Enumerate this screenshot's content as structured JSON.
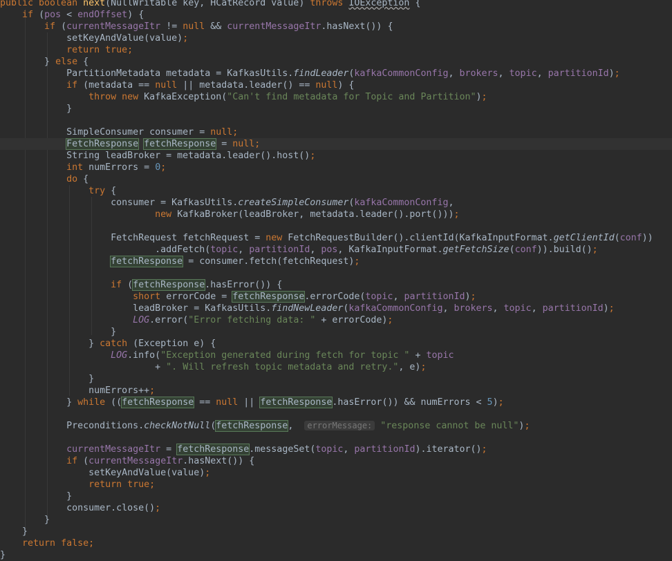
{
  "editor": {
    "theme_colors": {
      "background": "#2b2b2b",
      "text": "#a9b7c6",
      "keyword": "#cc7832",
      "field": "#9876aa",
      "method_declaration": "#ffc66d",
      "string": "#6a8759",
      "number": "#6897bb",
      "highlight": "#344134"
    },
    "lines": [
      {
        "segments": [
          {
            "t": "public boolean ",
            "c": "kw"
          },
          {
            "t": "next",
            "c": "fn"
          },
          {
            "t": "(NullWritable key, HCatRecord value) "
          },
          {
            "t": "throws ",
            "c": "kw"
          },
          {
            "t": "IOException",
            "c": "squiggle"
          },
          {
            "t": " {"
          }
        ]
      },
      {
        "segments": [
          {
            "t": "    "
          },
          {
            "t": "if ",
            "c": "kw"
          },
          {
            "t": "("
          },
          {
            "t": "pos",
            "c": "fld"
          },
          {
            "t": " < "
          },
          {
            "t": "endOffset",
            "c": "fld"
          },
          {
            "t": ") {"
          }
        ]
      },
      {
        "segments": [
          {
            "t": "        "
          },
          {
            "t": "if ",
            "c": "kw"
          },
          {
            "t": "("
          },
          {
            "t": "currentMessageItr",
            "c": "fld"
          },
          {
            "t": " != "
          },
          {
            "t": "null",
            "c": "kw"
          },
          {
            "t": " && "
          },
          {
            "t": "currentMessageItr",
            "c": "fld"
          },
          {
            "t": ".hasNext()) {"
          }
        ]
      },
      {
        "segments": [
          {
            "t": "            setKeyAndValue(value)"
          },
          {
            "t": ";",
            "c": "kw"
          }
        ]
      },
      {
        "segments": [
          {
            "t": "            "
          },
          {
            "t": "return true;",
            "c": "kw"
          }
        ]
      },
      {
        "segments": [
          {
            "t": "        } "
          },
          {
            "t": "else ",
            "c": "kw"
          },
          {
            "t": "{"
          }
        ]
      },
      {
        "segments": [
          {
            "t": "            PartitionMetadata metadata = KafkasUtils."
          },
          {
            "t": "findLeader",
            "c": "ital"
          },
          {
            "t": "("
          },
          {
            "t": "kafkaCommonConfig",
            "c": "fld"
          },
          {
            "t": ", "
          },
          {
            "t": "brokers",
            "c": "fld"
          },
          {
            "t": ", "
          },
          {
            "t": "topic",
            "c": "fld"
          },
          {
            "t": ", "
          },
          {
            "t": "partitionId",
            "c": "fld"
          },
          {
            "t": ")"
          },
          {
            "t": ";",
            "c": "kw"
          }
        ]
      },
      {
        "segments": [
          {
            "t": "            "
          },
          {
            "t": "if ",
            "c": "kw"
          },
          {
            "t": "(metadata == "
          },
          {
            "t": "null",
            "c": "kw"
          },
          {
            "t": " || metadata.leader() == "
          },
          {
            "t": "null",
            "c": "kw"
          },
          {
            "t": ") {"
          }
        ]
      },
      {
        "segments": [
          {
            "t": "                "
          },
          {
            "t": "throw new ",
            "c": "kw"
          },
          {
            "t": "KafkaException("
          },
          {
            "t": "\"Can't find metadata for Topic and Partition\"",
            "c": "str"
          },
          {
            "t": ")"
          },
          {
            "t": ";",
            "c": "kw"
          }
        ]
      },
      {
        "segments": [
          {
            "t": "            }"
          }
        ]
      },
      {
        "segments": []
      },
      {
        "segments": [
          {
            "t": "            SimpleConsumer consumer = "
          },
          {
            "t": "null;",
            "c": "kw"
          }
        ]
      },
      {
        "current": true,
        "segments": [
          {
            "t": "            "
          },
          {
            "t": "FetchResponse",
            "c": "hl"
          },
          {
            "t": " "
          },
          {
            "t": "fetchResponse",
            "c": "hl"
          },
          {
            "t": " = "
          },
          {
            "t": "null;",
            "c": "kw"
          }
        ]
      },
      {
        "segments": [
          {
            "t": "            String leadBroker = metadata.leader().host()"
          },
          {
            "t": ";",
            "c": "kw"
          }
        ]
      },
      {
        "segments": [
          {
            "t": "            "
          },
          {
            "t": "int ",
            "c": "kw"
          },
          {
            "t": "numErrors = "
          },
          {
            "t": "0",
            "c": "num"
          },
          {
            "t": ";",
            "c": "kw"
          }
        ]
      },
      {
        "segments": [
          {
            "t": "            "
          },
          {
            "t": "do ",
            "c": "kw"
          },
          {
            "t": "{"
          }
        ]
      },
      {
        "segments": [
          {
            "t": "                "
          },
          {
            "t": "try ",
            "c": "kw"
          },
          {
            "t": "{"
          }
        ]
      },
      {
        "segments": [
          {
            "t": "                    consumer = KafkasUtils."
          },
          {
            "t": "createSimpleConsumer",
            "c": "ital"
          },
          {
            "t": "("
          },
          {
            "t": "kafkaCommonConfig",
            "c": "fld"
          },
          {
            "t": ","
          }
        ]
      },
      {
        "segments": [
          {
            "t": "                            "
          },
          {
            "t": "new ",
            "c": "kw"
          },
          {
            "t": "KafkaBroker(leadBroker, metadata.leader().port()))"
          },
          {
            "t": ";",
            "c": "kw"
          }
        ]
      },
      {
        "segments": []
      },
      {
        "segments": [
          {
            "t": "                    FetchRequest fetchRequest = "
          },
          {
            "t": "new ",
            "c": "kw"
          },
          {
            "t": "FetchRequestBuilder().clientId(KafkaInputFormat."
          },
          {
            "t": "getClientId",
            "c": "ital"
          },
          {
            "t": "("
          },
          {
            "t": "conf",
            "c": "fld"
          },
          {
            "t": "))"
          }
        ]
      },
      {
        "segments": [
          {
            "t": "                            .addFetch("
          },
          {
            "t": "topic",
            "c": "fld"
          },
          {
            "t": ", "
          },
          {
            "t": "partitionId",
            "c": "fld"
          },
          {
            "t": ", "
          },
          {
            "t": "pos",
            "c": "fld"
          },
          {
            "t": ", KafkaInputFormat."
          },
          {
            "t": "getFetchSize",
            "c": "ital"
          },
          {
            "t": "("
          },
          {
            "t": "conf",
            "c": "fld"
          },
          {
            "t": ")).build()"
          },
          {
            "t": ";",
            "c": "kw"
          }
        ]
      },
      {
        "segments": [
          {
            "t": "                    "
          },
          {
            "t": "fetchResponse",
            "c": "hl"
          },
          {
            "t": " = consumer.fetch(fetchRequest)"
          },
          {
            "t": ";",
            "c": "kw"
          }
        ]
      },
      {
        "segments": []
      },
      {
        "segments": [
          {
            "t": "                    "
          },
          {
            "t": "if ",
            "c": "kw"
          },
          {
            "t": "("
          },
          {
            "t": "fetchResponse",
            "c": "hl"
          },
          {
            "t": ".hasError()) {"
          }
        ]
      },
      {
        "segments": [
          {
            "t": "                        "
          },
          {
            "t": "short ",
            "c": "kw"
          },
          {
            "t": "errorCode = "
          },
          {
            "t": "fetchResponse",
            "c": "hl"
          },
          {
            "t": ".errorCode("
          },
          {
            "t": "topic",
            "c": "fld"
          },
          {
            "t": ", "
          },
          {
            "t": "partitionId",
            "c": "fld"
          },
          {
            "t": ")"
          },
          {
            "t": ";",
            "c": "kw"
          }
        ]
      },
      {
        "segments": [
          {
            "t": "                        leadBroker = KafkasUtils."
          },
          {
            "t": "findNewLeader",
            "c": "ital"
          },
          {
            "t": "("
          },
          {
            "t": "kafkaCommonConfig",
            "c": "fld"
          },
          {
            "t": ", "
          },
          {
            "t": "brokers",
            "c": "fld"
          },
          {
            "t": ", "
          },
          {
            "t": "topic",
            "c": "fld"
          },
          {
            "t": ", "
          },
          {
            "t": "partitionId",
            "c": "fld"
          },
          {
            "t": ")"
          },
          {
            "t": ";",
            "c": "kw"
          }
        ]
      },
      {
        "segments": [
          {
            "t": "                        "
          },
          {
            "t": "LOG",
            "c": "fld ital"
          },
          {
            "t": ".error("
          },
          {
            "t": "\"Error fetching data: \"",
            "c": "str"
          },
          {
            "t": " + errorCode)"
          },
          {
            "t": ";",
            "c": "kw"
          }
        ]
      },
      {
        "segments": [
          {
            "t": "                    }"
          }
        ]
      },
      {
        "segments": [
          {
            "t": "                } "
          },
          {
            "t": "catch ",
            "c": "kw"
          },
          {
            "t": "(Exception e) {"
          }
        ]
      },
      {
        "segments": [
          {
            "t": "                    "
          },
          {
            "t": "LOG",
            "c": "fld ital"
          },
          {
            "t": ".info("
          },
          {
            "t": "\"Exception generated during fetch for topic \"",
            "c": "str"
          },
          {
            "t": " + "
          },
          {
            "t": "topic",
            "c": "fld"
          }
        ]
      },
      {
        "segments": [
          {
            "t": "                            + "
          },
          {
            "t": "\". Will refresh topic metadata and retry.\"",
            "c": "str"
          },
          {
            "t": ", e)"
          },
          {
            "t": ";",
            "c": "kw"
          }
        ]
      },
      {
        "segments": [
          {
            "t": "                }"
          }
        ]
      },
      {
        "segments": [
          {
            "t": "                numErrors++"
          },
          {
            "t": ";",
            "c": "kw"
          }
        ]
      },
      {
        "segments": [
          {
            "t": "            } "
          },
          {
            "t": "while ",
            "c": "kw"
          },
          {
            "t": "(("
          },
          {
            "t": "fetchResponse",
            "c": "hl"
          },
          {
            "t": " == "
          },
          {
            "t": "null",
            "c": "kw"
          },
          {
            "t": " || "
          },
          {
            "t": "fetchResponse",
            "c": "hl"
          },
          {
            "t": ".hasError()) && numErrors < "
          },
          {
            "t": "5",
            "c": "num"
          },
          {
            "t": ")"
          },
          {
            "t": ";",
            "c": "kw"
          }
        ]
      },
      {
        "segments": []
      },
      {
        "segments": [
          {
            "t": "            Preconditions."
          },
          {
            "t": "checkNotNull",
            "c": "ital"
          },
          {
            "t": "("
          },
          {
            "t": "fetchResponse",
            "c": "hl"
          },
          {
            "t": ",  "
          },
          {
            "t": "errorMessage:",
            "c": "hint"
          },
          {
            "t": " "
          },
          {
            "t": "\"response cannot be null\"",
            "c": "str"
          },
          {
            "t": ")"
          },
          {
            "t": ";",
            "c": "kw"
          }
        ]
      },
      {
        "segments": []
      },
      {
        "segments": [
          {
            "t": "            "
          },
          {
            "t": "currentMessageItr",
            "c": "fld"
          },
          {
            "t": " = "
          },
          {
            "t": "fetchResponse",
            "c": "hl"
          },
          {
            "t": ".messageSet("
          },
          {
            "t": "topic",
            "c": "fld"
          },
          {
            "t": ", "
          },
          {
            "t": "partitionId",
            "c": "fld"
          },
          {
            "t": ").iterator()"
          },
          {
            "t": ";",
            "c": "kw"
          }
        ]
      },
      {
        "segments": [
          {
            "t": "            "
          },
          {
            "t": "if ",
            "c": "kw"
          },
          {
            "t": "("
          },
          {
            "t": "currentMessageItr",
            "c": "fld"
          },
          {
            "t": ".hasNext()) {"
          }
        ]
      },
      {
        "segments": [
          {
            "t": "                setKeyAndValue(value)"
          },
          {
            "t": ";",
            "c": "kw"
          }
        ]
      },
      {
        "segments": [
          {
            "t": "                "
          },
          {
            "t": "return true;",
            "c": "kw"
          }
        ]
      },
      {
        "segments": [
          {
            "t": "            }"
          }
        ]
      },
      {
        "segments": [
          {
            "t": "            consumer.close()"
          },
          {
            "t": ";",
            "c": "kw"
          }
        ]
      },
      {
        "segments": [
          {
            "t": "        }"
          }
        ]
      },
      {
        "segments": [
          {
            "t": "    }"
          }
        ]
      },
      {
        "segments": [
          {
            "t": "    "
          },
          {
            "t": "return false;",
            "c": "kw"
          }
        ]
      },
      {
        "segments": [
          {
            "t": "}"
          }
        ]
      }
    ]
  }
}
